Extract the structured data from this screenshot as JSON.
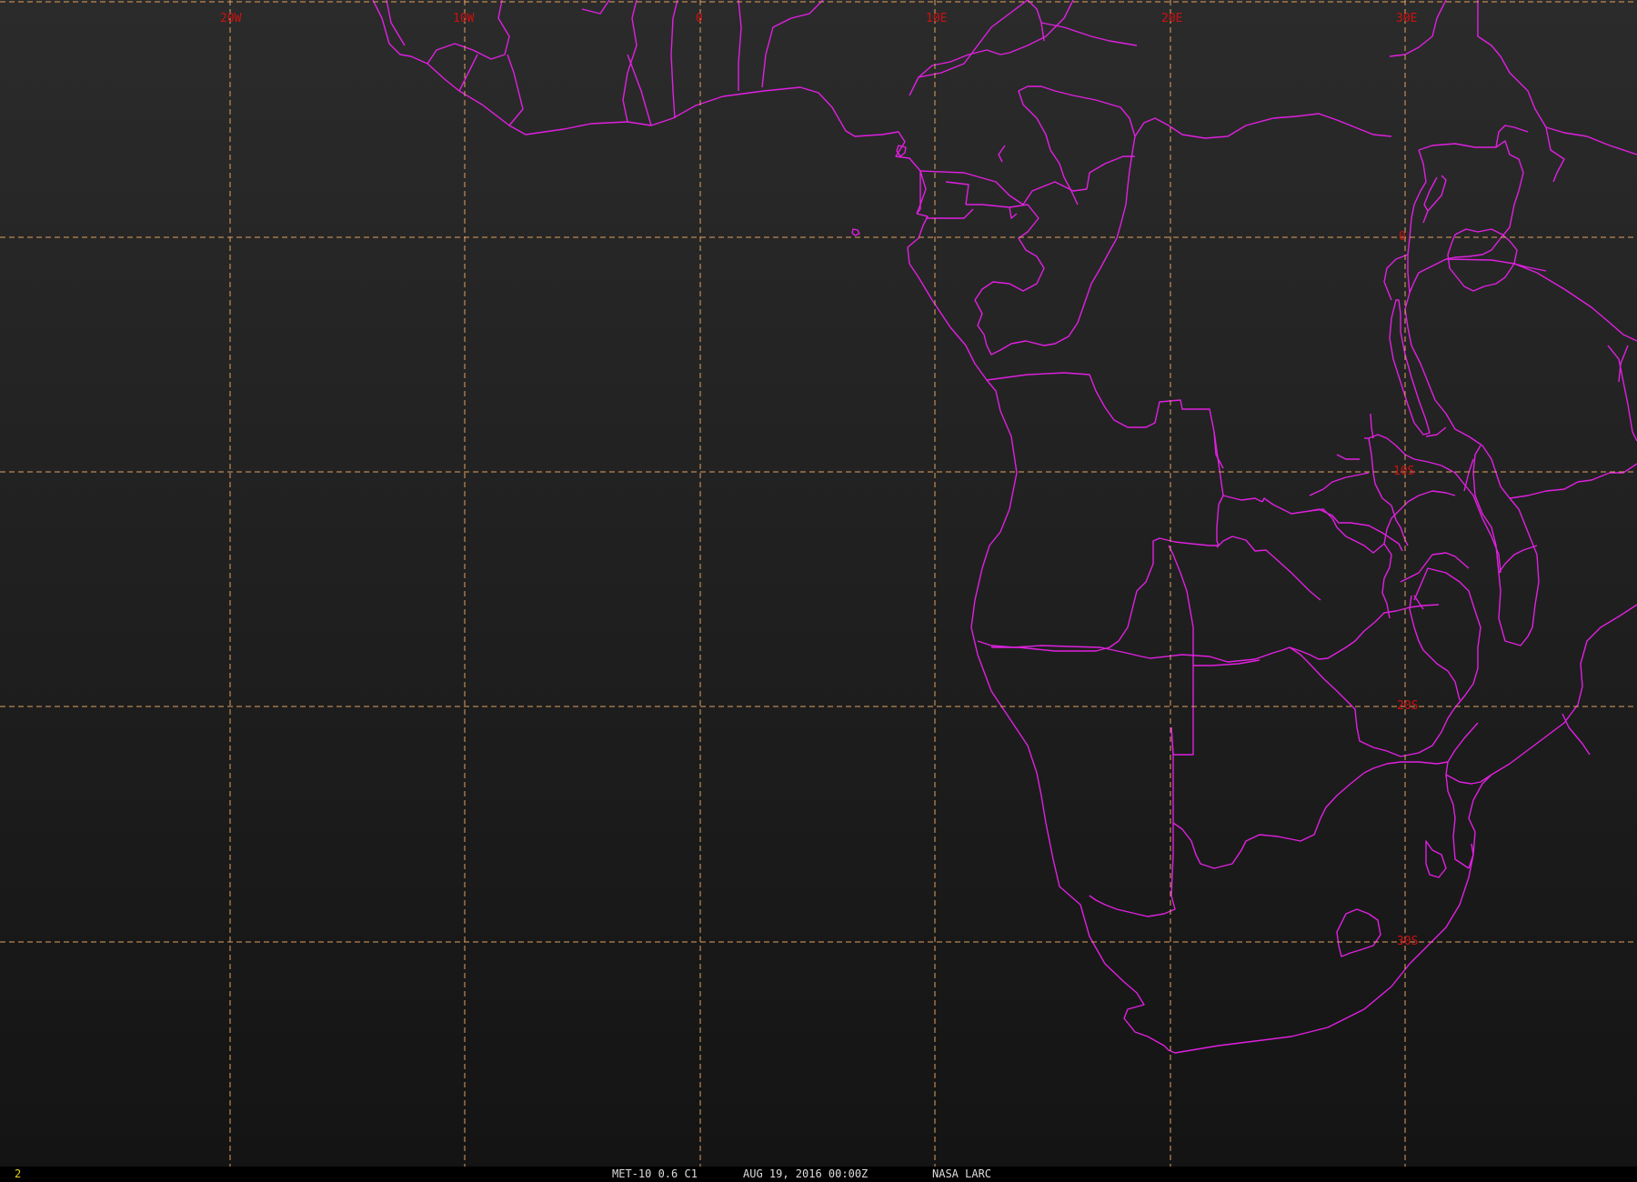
{
  "map": {
    "graticule": {
      "longitude_labels": [
        "20W",
        "10W",
        "0",
        "10E",
        "20E",
        "30E"
      ],
      "latitude_labels": [
        "0",
        "10S",
        "20S",
        "30S"
      ]
    }
  },
  "status_bar": {
    "frame_number": "2",
    "satellite_channel": "MET-10 0.6 C1",
    "date_time": "AUG 19, 2016 00:00Z",
    "producer": "NASA LARC"
  },
  "colors": {
    "background_top": "#2b2b2b",
    "background_bottom": "#141414",
    "boundaries": "#e020e0",
    "gridlines": "#e0a060",
    "grid_labels": "#cc1111",
    "status_text": "#dddddd",
    "frame_number": "#e8d020"
  }
}
